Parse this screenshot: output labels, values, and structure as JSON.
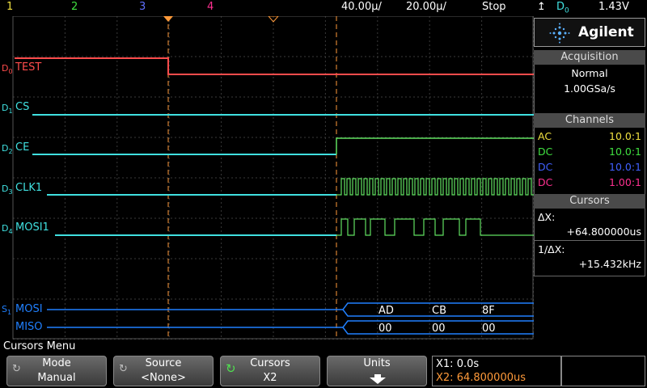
{
  "topbar": {
    "ch1": "1",
    "ch2": "2",
    "ch3": "3",
    "ch4": "4",
    "timebase": "40.00µ/",
    "delay": "20.00µ/",
    "run_state": "Stop",
    "trigger_source": "D",
    "trigger_source_sub": "0",
    "trigger_level": "1.43V"
  },
  "channels": [
    {
      "id": "D",
      "sub": "0",
      "name": "TEST",
      "color": "#ff4c4c"
    },
    {
      "id": "D",
      "sub": "1",
      "name": "CS",
      "color": "#40e0e0"
    },
    {
      "id": "D",
      "sub": "2",
      "name": "CE",
      "color": "#40e0e0"
    },
    {
      "id": "D",
      "sub": "3",
      "name": "CLK1",
      "color": "#40e0e0"
    },
    {
      "id": "D",
      "sub": "4",
      "name": "MOSI1",
      "color": "#40e0e0"
    }
  ],
  "serial": {
    "id": "S",
    "sub": "1",
    "mosi_label": "MOSI",
    "miso_label": "MISO",
    "mosi_values": [
      "AD",
      "CB",
      "8F"
    ],
    "miso_values": [
      "00",
      "00",
      "00"
    ]
  },
  "panel": {
    "brand": "Agilent",
    "acquisition_title": "Acquisition",
    "acq_mode": "Normal",
    "acq_rate": "1.00GSa/s",
    "channels_title": "Channels",
    "channel_rows": [
      {
        "coupling": "AC",
        "probe": "10.0:1",
        "color": "#f0e040"
      },
      {
        "coupling": "DC",
        "probe": "10.0:1",
        "color": "#40e040"
      },
      {
        "coupling": "DC",
        "probe": "10.0:1",
        "color": "#4060ff"
      },
      {
        "coupling": "DC",
        "probe": "1.00:1",
        "color": "#ff3090"
      }
    ],
    "cursors_title": "Cursors",
    "dx_label": "ΔX:",
    "dx_value": "+64.800000us",
    "inv_dx_label": "1/ΔX:",
    "inv_dx_value": "+15.432kHz"
  },
  "menu": {
    "title": "Cursors Menu",
    "softkeys": [
      {
        "label": "Mode",
        "value": "Manual"
      },
      {
        "label": "Source",
        "value": "<None>"
      },
      {
        "label": "Cursors",
        "value": "X2"
      },
      {
        "label": "Units",
        "value": ""
      }
    ],
    "x1": "X1: 0.0s",
    "x2": "X2: 64.800000us"
  },
  "colors": {
    "cursor": "#ff9a3a",
    "digital": "#40e0e0",
    "serial_bus": "#2080ff",
    "high_green": "#60e060"
  }
}
